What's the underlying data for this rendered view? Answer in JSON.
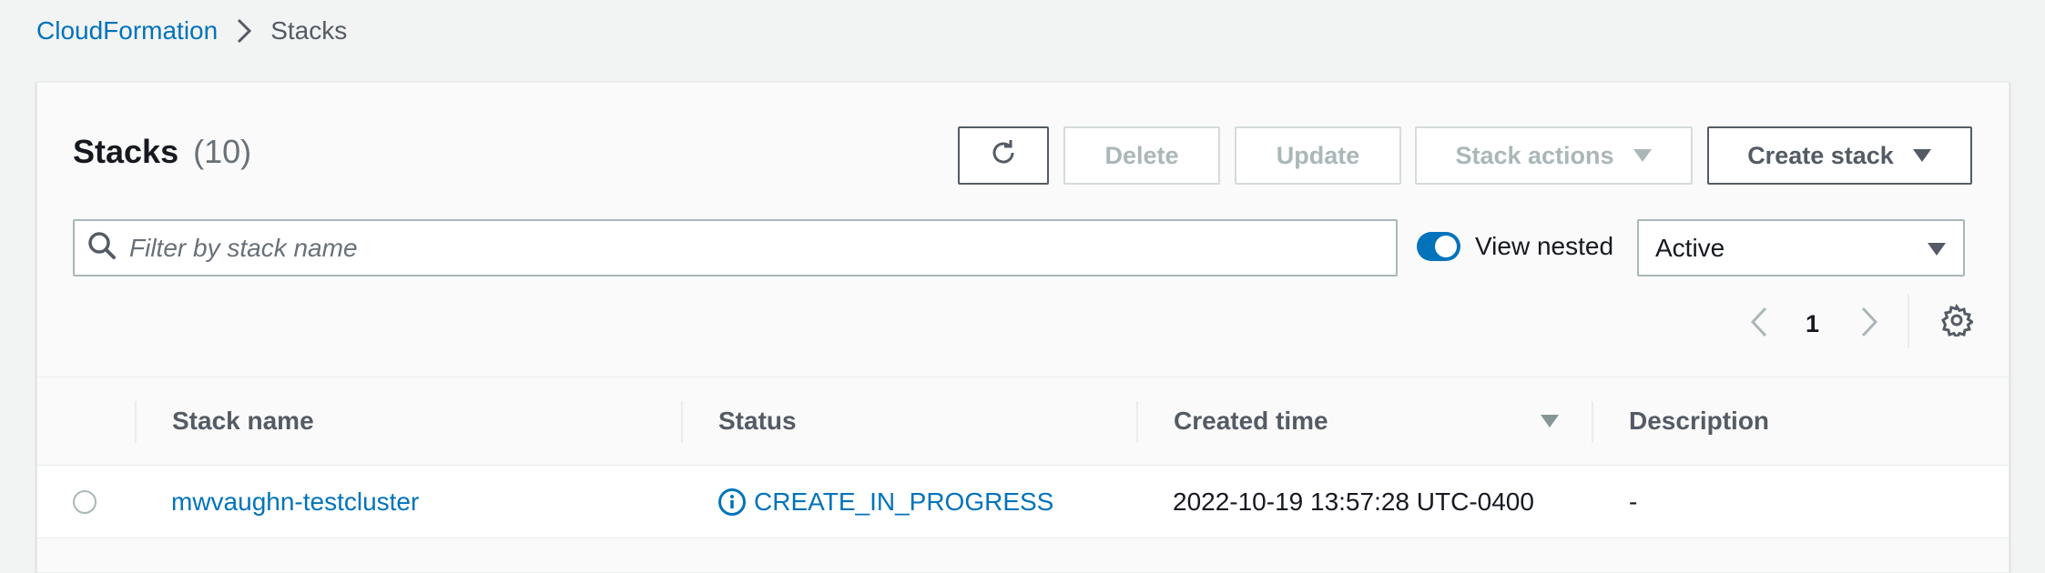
{
  "breadcrumb": {
    "root": "CloudFormation",
    "current": "Stacks"
  },
  "panel": {
    "title": "Stacks",
    "count": "(10)"
  },
  "toolbar": {
    "delete_label": "Delete",
    "update_label": "Update",
    "stack_actions_label": "Stack actions",
    "create_stack_label": "Create stack"
  },
  "filter": {
    "placeholder": "Filter by stack name",
    "value": ""
  },
  "view_nested": {
    "label": "View nested",
    "enabled": true
  },
  "status_filter": {
    "selected": "Active"
  },
  "pagination": {
    "current_page": "1"
  },
  "table": {
    "columns": [
      "Stack name",
      "Status",
      "Created time",
      "Description"
    ],
    "rows": [
      {
        "stack_name": "mwvaughn-testcluster",
        "status": "CREATE_IN_PROGRESS",
        "created_time": "2022-10-19 13:57:28 UTC-0400",
        "description": "-"
      }
    ]
  },
  "colors": {
    "link": "#0073bb",
    "background": "#f2f3f3",
    "panel": "#fafafa",
    "disabled_text": "#aab7b8",
    "header_text": "#545b64"
  },
  "icons": [
    "chevron-right-icon",
    "refresh-icon",
    "caret-down-icon",
    "search-icon",
    "chevron-left-icon",
    "settings-gear-icon",
    "info-circle-icon"
  ]
}
